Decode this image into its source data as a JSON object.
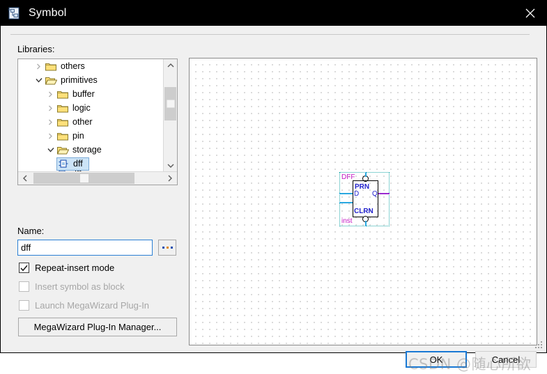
{
  "window": {
    "title": "Symbol",
    "icon": "symbol-document-icon",
    "close_label": "×"
  },
  "left_panel": {
    "libraries_label": "Libraries:",
    "tree": [
      {
        "label": "others",
        "depth": 1,
        "type": "folder",
        "expanded": false,
        "selected": false
      },
      {
        "label": "primitives",
        "depth": 1,
        "type": "folder",
        "expanded": true,
        "selected": false
      },
      {
        "label": "buffer",
        "depth": 2,
        "type": "folder",
        "expanded": false,
        "selected": false
      },
      {
        "label": "logic",
        "depth": 2,
        "type": "folder",
        "expanded": false,
        "selected": false
      },
      {
        "label": "other",
        "depth": 2,
        "type": "folder",
        "expanded": false,
        "selected": false
      },
      {
        "label": "pin",
        "depth": 2,
        "type": "folder",
        "expanded": false,
        "selected": false
      },
      {
        "label": "storage",
        "depth": 2,
        "type": "folder",
        "expanded": true,
        "selected": false
      },
      {
        "label": "dff",
        "depth": 3,
        "type": "symbol",
        "expanded": false,
        "selected": true
      },
      {
        "label": "dffe",
        "depth": 3,
        "type": "symbol",
        "expanded": false,
        "selected": false
      }
    ],
    "name_label": "Name:",
    "name_value": "dff",
    "name_placeholder": "",
    "browse_label": "...",
    "checkboxes": [
      {
        "label": "Repeat-insert mode",
        "checked": true,
        "enabled": true
      },
      {
        "label": "Insert symbol as block",
        "checked": false,
        "enabled": false
      },
      {
        "label": "Launch MegaWizard Plug-In",
        "checked": false,
        "enabled": false
      }
    ],
    "megawizard_button": "MegaWizard Plug-In Manager..."
  },
  "preview": {
    "symbol_name": "DFF",
    "instance_name": "inst",
    "ports": {
      "preset": "PRN",
      "clear": "CLRN",
      "data": "D",
      "output": "Q"
    }
  },
  "footer": {
    "ok_label": "OK",
    "cancel_label": "Cancel"
  },
  "watermark": {
    "text": "CSDN @随心所欲"
  },
  "colors": {
    "titlebar_bg": "#000000",
    "dialog_bg": "#f0f0f0",
    "accent_blue": "#1878d4",
    "selection_blue": "#cce4f7",
    "symbol_magenta": "#c418c4",
    "port_blue": "#2222cc",
    "wire_cyan": "#2aa8e0",
    "wire_purple": "#9a2ad0",
    "dash_teal": "#18a8a8",
    "folder_yellow": "#ffdd55"
  }
}
